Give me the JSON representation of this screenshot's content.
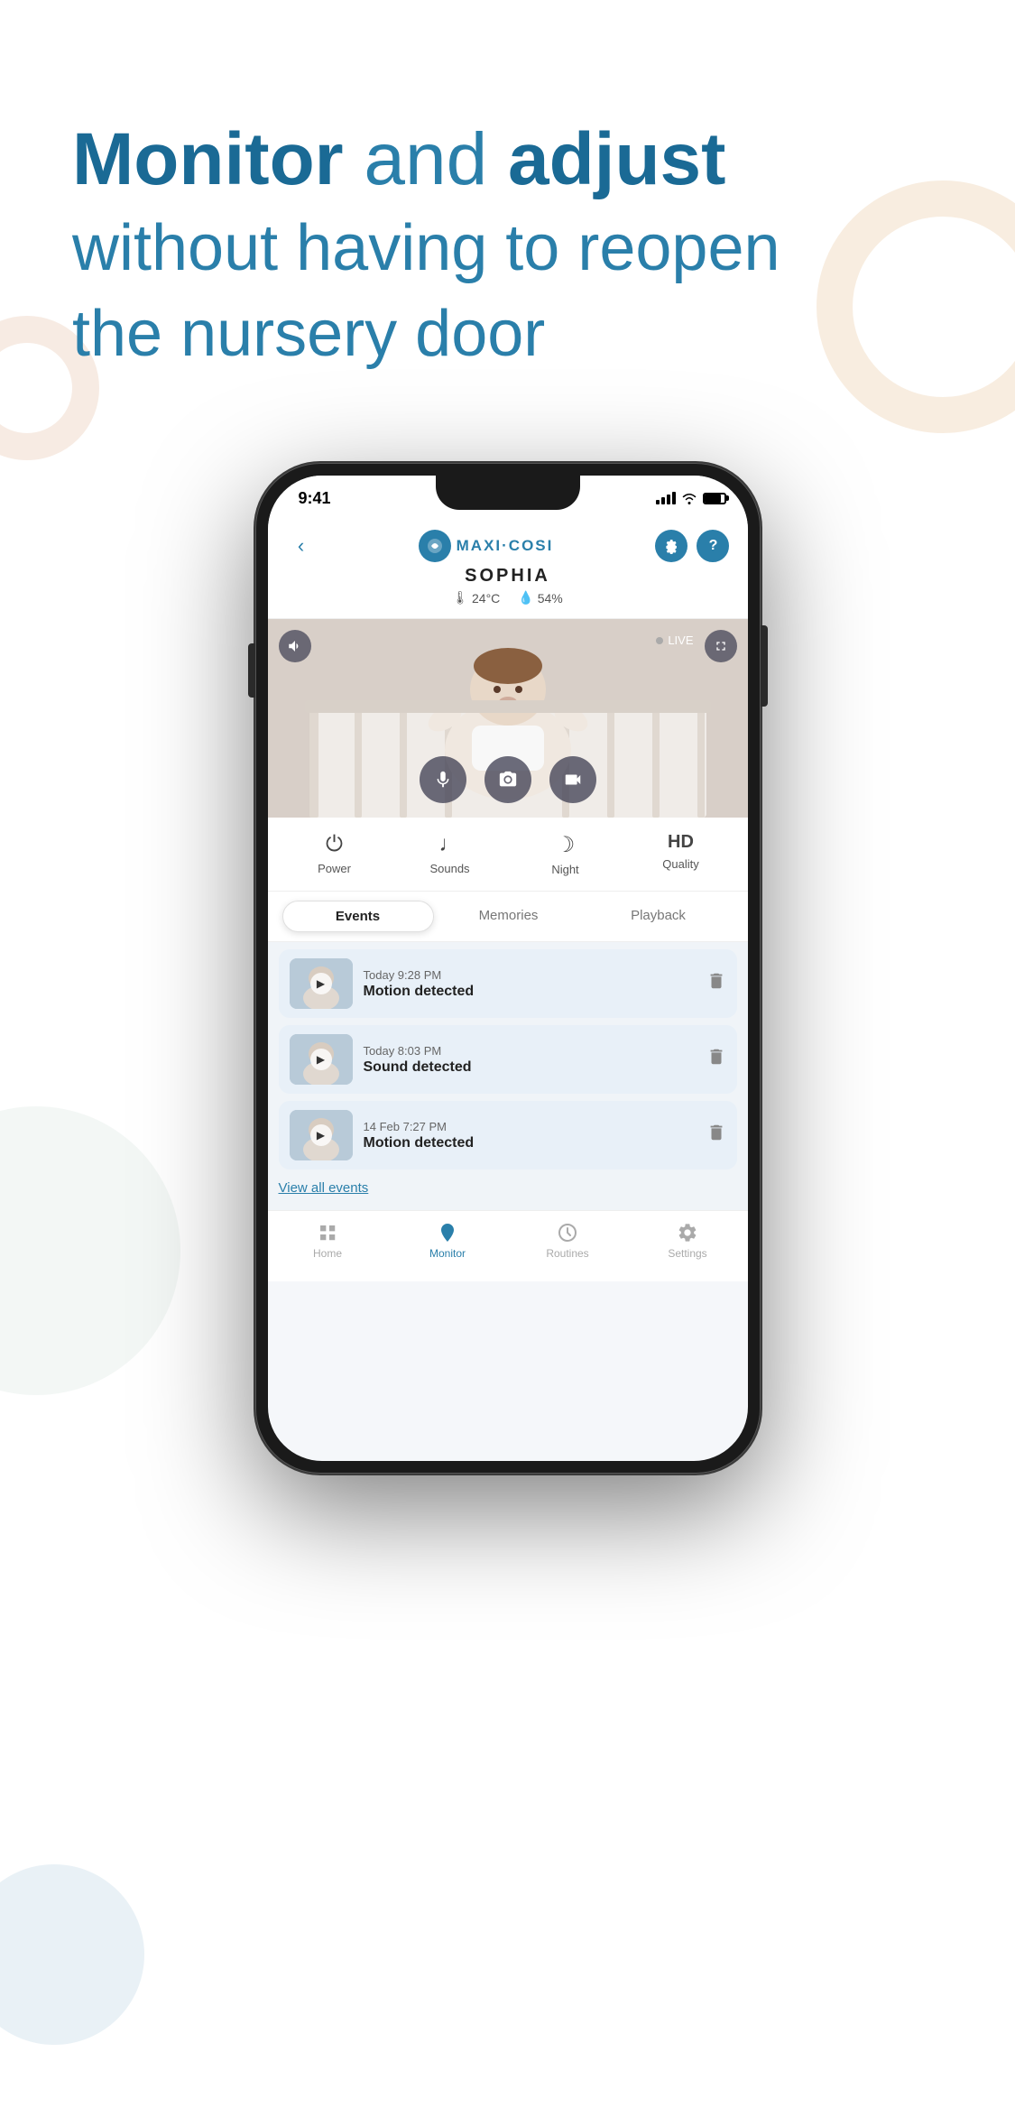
{
  "hero": {
    "line1_prefix": "Monitor",
    "line1_mid": " and ",
    "line1_suffix": "adjust",
    "line2": "without having to reopen",
    "line3": "the nursery door"
  },
  "status_bar": {
    "time": "9:41"
  },
  "header": {
    "brand": "MAXI·COSI",
    "device_name": "SOPHIA",
    "temp": "24°C",
    "humidity": "54%"
  },
  "camera": {
    "live_text": "LIVE"
  },
  "features": [
    {
      "icon": "⏻",
      "label": "Power"
    },
    {
      "icon": "♪",
      "label": "Sounds"
    },
    {
      "icon": "☽",
      "label": "Night"
    },
    {
      "icon": "HD",
      "label": "Quality"
    }
  ],
  "tabs": [
    {
      "label": "Events",
      "active": true
    },
    {
      "label": "Memories",
      "active": false
    },
    {
      "label": "Playback",
      "active": false
    }
  ],
  "events": [
    {
      "time": "Today 9:28 PM",
      "description": "Motion detected"
    },
    {
      "time": "Today 8:03 PM",
      "description": "Sound detected"
    },
    {
      "time": "14 Feb 7:27 PM",
      "description": "Motion detected"
    }
  ],
  "view_all": "View all events",
  "bottom_nav": [
    {
      "label": "Home",
      "icon": "grid",
      "active": false
    },
    {
      "label": "Monitor",
      "icon": "monitor",
      "active": true
    },
    {
      "label": "Routines",
      "icon": "clock",
      "active": false
    },
    {
      "label": "Settings",
      "icon": "gear",
      "active": false
    }
  ]
}
